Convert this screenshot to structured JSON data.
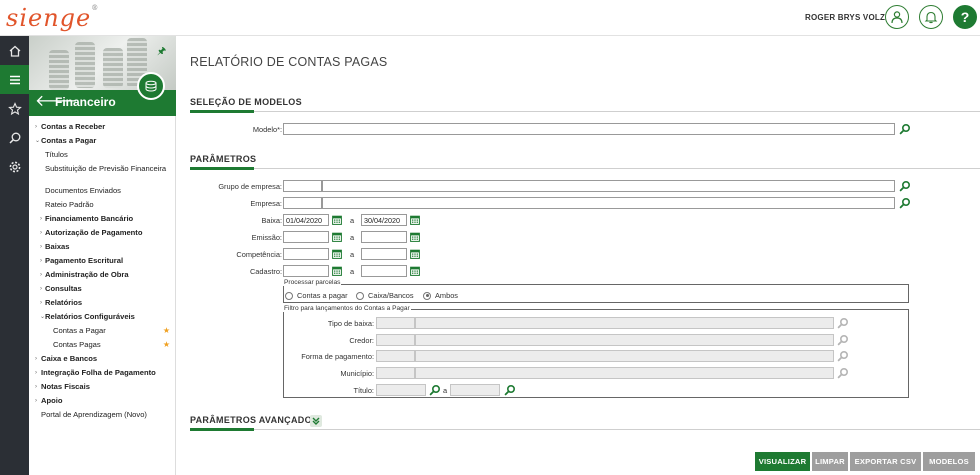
{
  "header": {
    "logo": "sienge",
    "logo_reg": "®",
    "user": "ROGER BRYS VOLZ",
    "help": "?"
  },
  "rail": {
    "icons": [
      "home-icon",
      "menu-icon",
      "star-icon",
      "search-icon",
      "gear-icon"
    ]
  },
  "sidebar": {
    "module_title": "Financeiro",
    "pin": "🖈",
    "menu": [
      {
        "label": "Contas a Receber"
      },
      {
        "label": "Contas a Pagar"
      },
      {
        "label": "Títulos"
      },
      {
        "label": "Substituição de Previsão Financeira"
      },
      {
        "label": "Documentos Enviados"
      },
      {
        "label": "Rateio Padrão"
      },
      {
        "label": "Financiamento Bancário"
      },
      {
        "label": "Autorização de Pagamento"
      },
      {
        "label": "Baixas"
      },
      {
        "label": "Pagamento Escritural"
      },
      {
        "label": "Administração de Obra"
      },
      {
        "label": "Consultas"
      },
      {
        "label": "Relatórios"
      },
      {
        "label": "Relatórios Configuráveis"
      },
      {
        "label": "Contas a Pagar"
      },
      {
        "label": "Contas Pagas"
      },
      {
        "label": "Caixa e Bancos"
      },
      {
        "label": "Integração Folha de Pagamento"
      },
      {
        "label": "Notas Fiscais"
      },
      {
        "label": "Apoio"
      },
      {
        "label": "Portal de Aprendizagem (Novo)"
      }
    ]
  },
  "main": {
    "page_title": "RELATÓRIO DE CONTAS PAGAS",
    "section_models": "SELEÇÃO DE MODELOS",
    "modelo_label": "Modelo*:",
    "section_params": "PARÂMETROS",
    "labels": {
      "grupo": "Grupo de empresa:",
      "empresa": "Empresa:",
      "baixa": "Baixa:",
      "emissao": "Emissão:",
      "competencia": "Competência:",
      "cadastro": "Cadastro:",
      "a": "a"
    },
    "baixa_from": "01/04/2020",
    "baixa_to": "30/04/2020",
    "parcelas": {
      "legend": "Processar parcelas",
      "options": [
        "Contas a pagar",
        "Caixa/Bancos",
        "Ambos"
      ],
      "selected": "Ambos"
    },
    "filtro": {
      "legend": "Filtro para lançamentos do Contas a Pagar",
      "tipo_baixa": "Tipo de baixa:",
      "credor": "Credor:",
      "forma_pagamento": "Forma de pagamento:",
      "municipio": "Município:",
      "titulo": "Título:",
      "a": "a"
    },
    "section_advanced": "PARÂMETROS AVANÇADOS"
  },
  "buttons": {
    "visualizar": "VISUALIZAR",
    "limpar": "LIMPAR",
    "exportar": "EXPORTAR CSV",
    "modelos": "MODELOS"
  },
  "colors": {
    "brand_green": "#1e7a32",
    "logo_orange": "#e1552b",
    "star": "#f0a020",
    "rail": "#2b2f35"
  }
}
